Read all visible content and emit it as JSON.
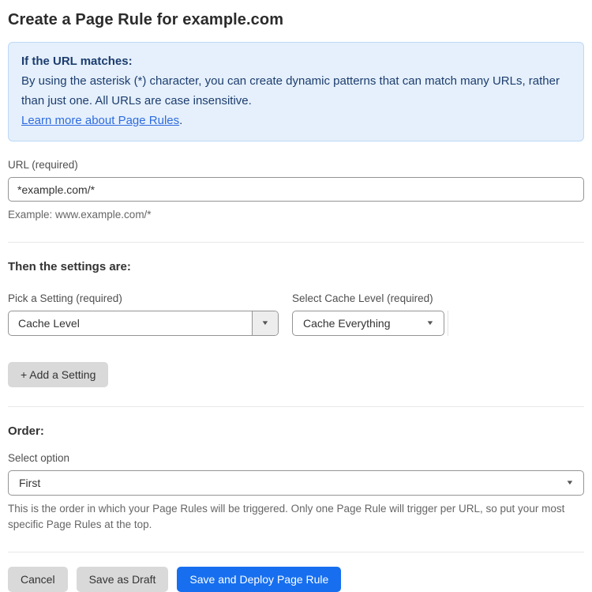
{
  "page": {
    "title": "Create a Page Rule for example.com"
  },
  "info_box": {
    "heading": "If the URL matches:",
    "body": "By using the asterisk (*) character, you can create dynamic patterns that can match many URLs, rather than just one. All URLs are case insensitive.",
    "link_label": "Learn more about Page Rules",
    "link_suffix": "."
  },
  "url_field": {
    "label": "URL (required)",
    "value": "*example.com/*",
    "helper": "Example: www.example.com/*"
  },
  "settings_section": {
    "heading": "Then the settings are:",
    "setting_label": "Pick a Setting (required)",
    "setting_value": "Cache Level",
    "cache_label": "Select Cache Level (required)",
    "cache_value": "Cache Everything",
    "add_setting_label": "+ Add a Setting"
  },
  "order_section": {
    "heading": "Order:",
    "label": "Select option",
    "value": "First",
    "helper": "This is the order in which your Page Rules will be triggered. Only one Page Rule will trigger per URL, so put your most specific Page Rules at the top."
  },
  "footer": {
    "cancel_label": "Cancel",
    "save_draft_label": "Save as Draft",
    "save_deploy_label": "Save and Deploy Page Rule"
  },
  "icons": {
    "caret_down": "▼"
  },
  "colors": {
    "info_background": "#e5f0fc",
    "info_border": "#bed9f6",
    "info_text": "#1d3d6e",
    "link": "#2f6bdf",
    "primary_button": "#176fef",
    "secondary_button": "#d9d9d9"
  }
}
